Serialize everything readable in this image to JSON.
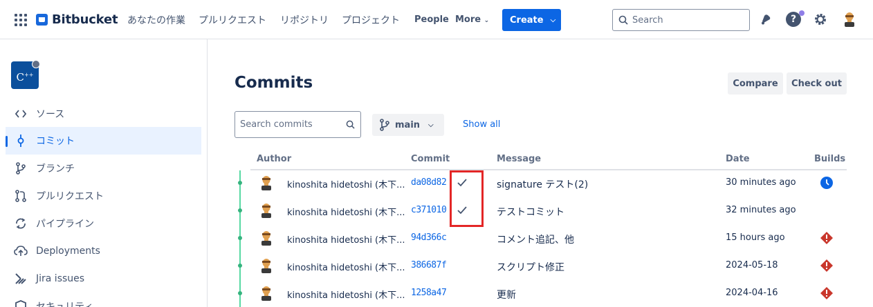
{
  "nav": {
    "app_name": "Bitbucket",
    "links": [
      "あなたの作業",
      "プルリクエスト",
      "リポジトリ",
      "プロジェクト"
    ],
    "people": "People",
    "more": "More",
    "create": "Create",
    "search_placeholder": "Search"
  },
  "sidebar": {
    "repo_avatar_text": "C",
    "items": [
      {
        "label": "ソース",
        "icon": "code-icon"
      },
      {
        "label": "コミット",
        "icon": "commit-icon"
      },
      {
        "label": "ブランチ",
        "icon": "branch-icon"
      },
      {
        "label": "プルリクエスト",
        "icon": "pull-request-icon"
      },
      {
        "label": "パイプライン",
        "icon": "pipeline-icon"
      },
      {
        "label": "Deployments",
        "icon": "cloud-upload-icon"
      },
      {
        "label": "Jira issues",
        "icon": "jira-icon"
      },
      {
        "label": "セキュリティ",
        "icon": "shield-icon"
      }
    ]
  },
  "main": {
    "title": "Commits",
    "compare": "Compare",
    "checkout": "Check out",
    "search_placeholder": "Search commits",
    "branch": "main",
    "show_all": "Show all",
    "columns": [
      "Author",
      "Commit",
      "Message",
      "Date",
      "Builds"
    ],
    "commits": [
      {
        "author": "kinoshita hidetoshi (木下...",
        "hash": "da08d82",
        "verified": true,
        "message": "signature テスト(2)",
        "date": "30 minutes ago",
        "build": "in-progress"
      },
      {
        "author": "kinoshita hidetoshi (木下...",
        "hash": "c371010",
        "verified": true,
        "message": "テストコミット",
        "date": "32 minutes ago",
        "build": "none"
      },
      {
        "author": "kinoshita hidetoshi (木下...",
        "hash": "94d366c",
        "verified": false,
        "message": "コメント追記、他",
        "date": "15 hours ago",
        "build": "failed"
      },
      {
        "author": "kinoshita hidetoshi (木下...",
        "hash": "386687f",
        "verified": false,
        "message": "スクリプト修正",
        "date": "2024-05-18",
        "build": "failed"
      },
      {
        "author": "kinoshita hidetoshi (木下...",
        "hash": "1258a47",
        "verified": false,
        "message": "更新",
        "date": "2024-04-16",
        "build": "failed"
      }
    ]
  },
  "colors": {
    "accent": "#0c66e4",
    "graph": "#36b37e",
    "failed": "#c9372c",
    "highlight": "#e32626"
  }
}
